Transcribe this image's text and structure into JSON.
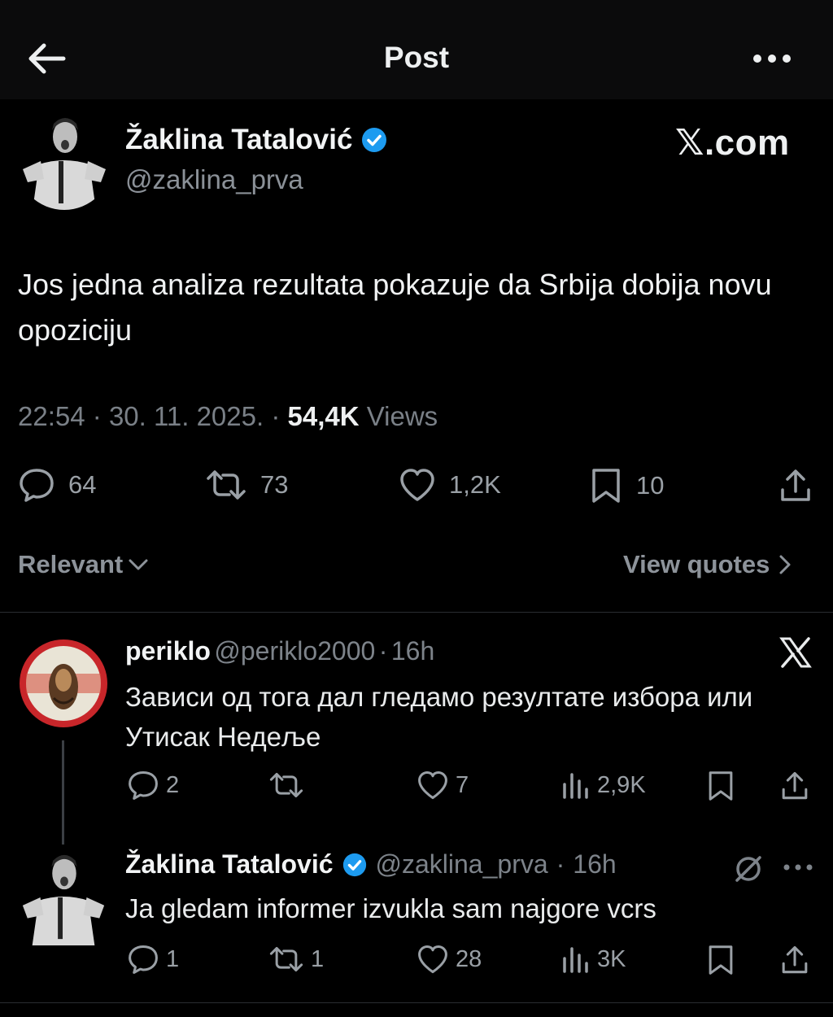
{
  "header": {
    "title": "Post"
  },
  "post": {
    "author": {
      "name": "Žaklina Tatalović",
      "handle": "@zaklina_prva",
      "verified": true
    },
    "source": "𝕏.com",
    "text": "Jos jedna analiza rezultata pokazuje da Srbija dobija novu opoziciju",
    "time": "22:54",
    "date": "30. 11. 2025.",
    "views_count": "54,4K",
    "views_label": "Views",
    "stats": {
      "replies": "64",
      "reposts": "73",
      "likes": "1,2K",
      "bookmarks": "10"
    }
  },
  "filters": {
    "sort_label": "Relevant",
    "quotes_label": "View quotes"
  },
  "replies": [
    {
      "name": "periklo",
      "handle": "@periklo2000",
      "time": "16h",
      "text": "Зависи од тога дал гледамо резултате избора или Утисак Недеље",
      "stats": {
        "replies": "2",
        "reposts": "",
        "likes": "7",
        "views": "2,9K"
      }
    },
    {
      "name": "Žaklina Tatalović",
      "handle": "@zaklina_prva",
      "time": "16h",
      "text": "Ja gledam informer izvukla sam najgore vcrs",
      "stats": {
        "replies": "1",
        "reposts": "1",
        "likes": "28",
        "views": "3K"
      }
    }
  ],
  "colors": {
    "background": "#000000",
    "verified_badge": "#1d9bf0",
    "muted_text": "#8b9198"
  }
}
